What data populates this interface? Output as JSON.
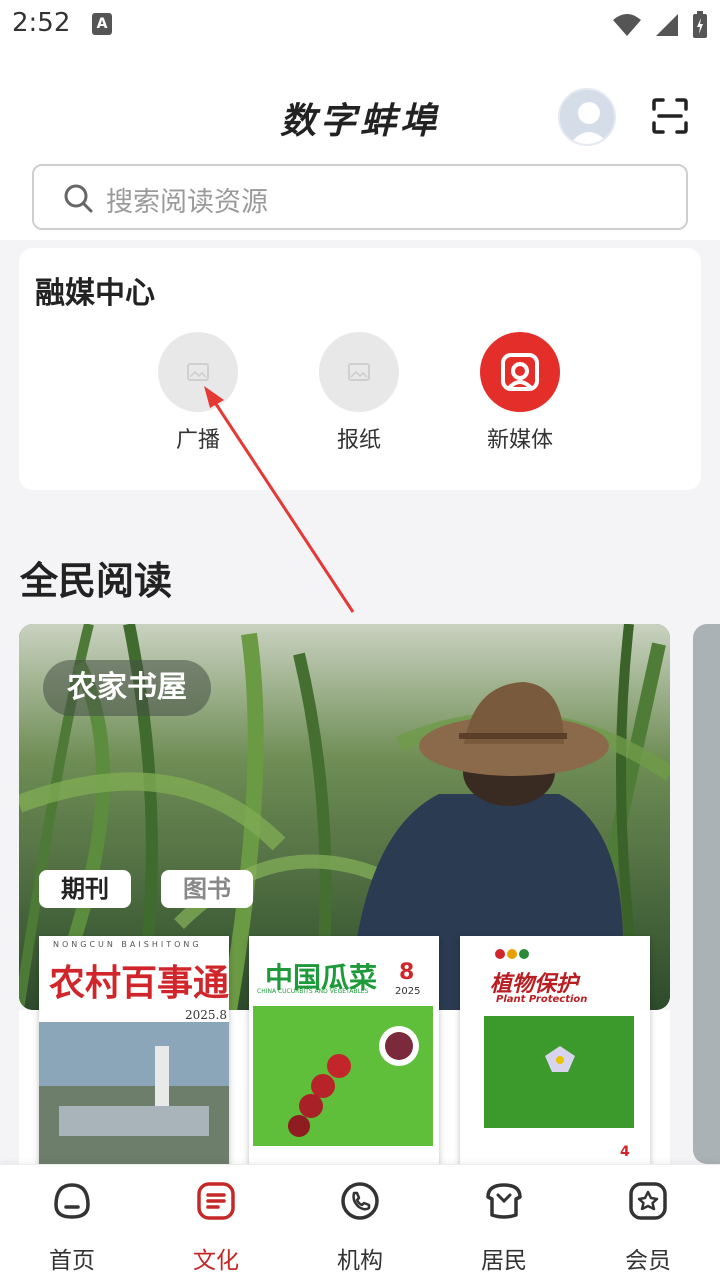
{
  "status": {
    "time": "2:52"
  },
  "header": {
    "title": "数字蚌埠",
    "search_placeholder": "搜索阅读资源"
  },
  "media_center": {
    "title": "融媒中心",
    "items": [
      {
        "label": "广播",
        "icon": "image-placeholder-icon"
      },
      {
        "label": "报纸",
        "icon": "image-placeholder-icon"
      },
      {
        "label": "新媒体",
        "icon": "new-media-icon",
        "color": "#e32e2a"
      }
    ]
  },
  "reading": {
    "title": "全民阅读",
    "banner_badge": "农家书屋",
    "tags": [
      "期刊",
      "图书"
    ],
    "books": [
      {
        "title": "农村百事通",
        "subtitle": "NONGCUN BAISHITONG",
        "issue": "2025.8"
      },
      {
        "title": "中国瓜菜",
        "subtitle": "CHINA CUCURBITS AND VEGETABLES",
        "issue": "8",
        "year": "2025"
      },
      {
        "title": "植物保护",
        "subtitle": "Plant Protection",
        "issue": "4"
      }
    ]
  },
  "tabs": [
    {
      "label": "首页",
      "icon": "home-icon"
    },
    {
      "label": "文化",
      "icon": "culture-icon",
      "active": true
    },
    {
      "label": "机构",
      "icon": "phone-icon"
    },
    {
      "label": "居民",
      "icon": "resident-icon"
    },
    {
      "label": "会员",
      "icon": "member-icon"
    }
  ],
  "colors": {
    "accent": "#c62828",
    "new_media": "#e32e2a"
  }
}
